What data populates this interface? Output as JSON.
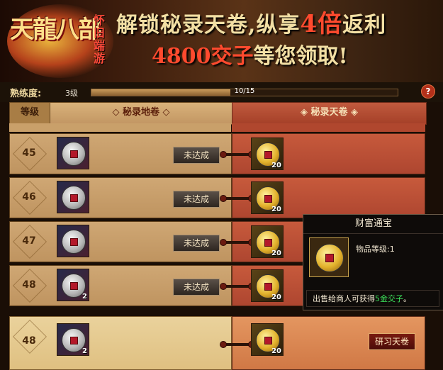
{
  "banner": {
    "logo": "天龍八部",
    "logo_sub": "怀旧端游",
    "slogan_line1_a": "解锁秘录天卷,纵享",
    "slogan_line1_big": "4倍",
    "slogan_line1_b": "返利",
    "slogan_line2_big": "4800交子",
    "slogan_line2_b": "等您领取!"
  },
  "proficiency": {
    "label": "熟练度:",
    "level": "3级",
    "progress_text": "10/15",
    "current": 10,
    "max": 15,
    "help": "?"
  },
  "headers": {
    "grade": "等级",
    "di_juan": "◇ 秘录地卷 ◇",
    "tian_juan": "◈ 秘录天卷 ◈"
  },
  "rows": [
    {
      "grade": "45",
      "left_count": "",
      "btn": "未达成",
      "right_count": "20"
    },
    {
      "grade": "46",
      "left_count": "",
      "btn": "未达成",
      "right_count": "20"
    },
    {
      "grade": "47",
      "left_count": "",
      "btn": "未达成",
      "right_count": "20"
    },
    {
      "grade": "48",
      "left_count": "2",
      "btn": "未达成",
      "right_count": "20"
    }
  ],
  "highlight_row": {
    "grade": "48",
    "left_count": "2",
    "right_count": "20",
    "btn": "研习天卷"
  },
  "tooltip": {
    "title": "财富通宝",
    "item_level": "物品等级:1",
    "sell_prefix": "出售给商人可获得",
    "sell_value": "5金交子",
    "sell_suffix": "。"
  },
  "colors": {
    "accent": "#b3301a",
    "gold": "#e3b22c",
    "green": "#3ce05a"
  }
}
